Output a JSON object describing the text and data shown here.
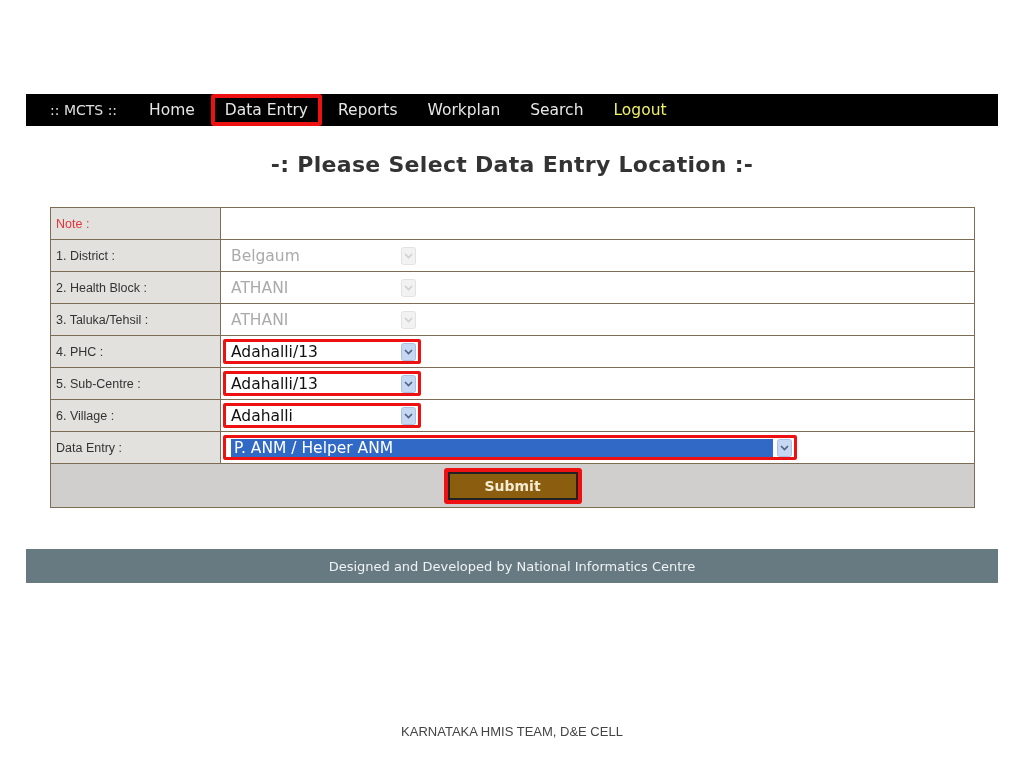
{
  "nav": {
    "brand": ":: MCTS ::",
    "items": [
      {
        "label": "Home",
        "highlighted": false,
        "kind": "link"
      },
      {
        "label": "Data Entry",
        "highlighted": true,
        "kind": "link"
      },
      {
        "label": "Reports",
        "highlighted": false,
        "kind": "link"
      },
      {
        "label": "Workplan",
        "highlighted": false,
        "kind": "link"
      },
      {
        "label": "Search",
        "highlighted": false,
        "kind": "link"
      },
      {
        "label": "Logout",
        "highlighted": false,
        "kind": "logout"
      }
    ]
  },
  "title": "-: Please Select Data Entry Location :-",
  "form": {
    "note_label": "Note :",
    "fields": [
      {
        "label": "1. District :",
        "value": "Belgaum",
        "disabled": true,
        "highlighted": false,
        "kind": "short"
      },
      {
        "label": "2. Health Block :",
        "value": "ATHANI",
        "disabled": true,
        "highlighted": false,
        "kind": "short"
      },
      {
        "label": "3. Taluka/Tehsil :",
        "value": "ATHANI",
        "disabled": true,
        "highlighted": false,
        "kind": "short"
      },
      {
        "label": "4. PHC :",
        "value": "Adahalli/13",
        "disabled": false,
        "highlighted": true,
        "kind": "short"
      },
      {
        "label": "5. Sub-Centre :",
        "value": "Adahalli/13",
        "disabled": false,
        "highlighted": true,
        "kind": "short"
      },
      {
        "label": "6. Village :",
        "value": "Adahalli",
        "disabled": false,
        "highlighted": true,
        "kind": "short"
      },
      {
        "label": "Data Entry :",
        "value": "P. ANM / Helper ANM",
        "disabled": false,
        "highlighted": true,
        "kind": "wide"
      }
    ],
    "submit": {
      "label": "Submit",
      "highlighted": true
    }
  },
  "footer": "Designed and Developed by National Informatics Centre",
  "slide_footer": "KARNATAKA HMIS TEAM, D&E CELL"
}
